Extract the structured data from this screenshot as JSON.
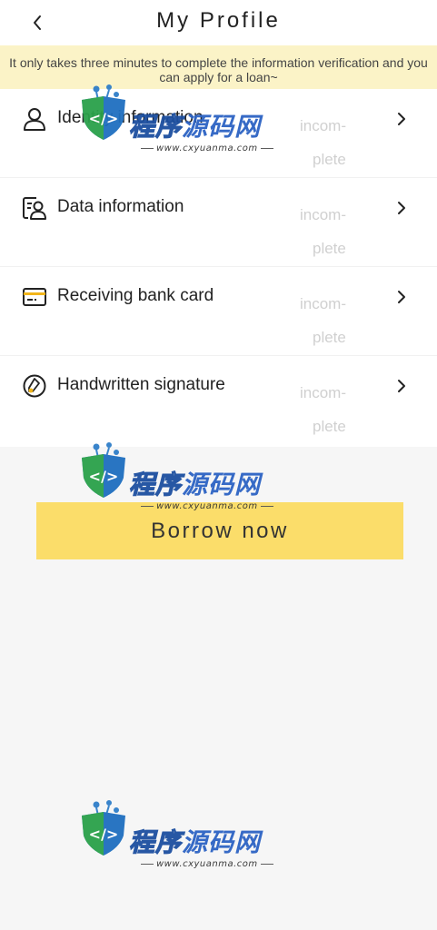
{
  "header": {
    "title": "My Profile",
    "back_icon": "chevron-left-icon"
  },
  "notice": {
    "line1": "It only takes three minutes to complete the information verification and you",
    "line2": "can apply for a loan~"
  },
  "items": [
    {
      "label": "Identity information",
      "status_line1": "incom-",
      "status_line2": "plete",
      "icon": "person-icon"
    },
    {
      "label": "Data information",
      "status_line1": "incom-",
      "status_line2": "plete",
      "icon": "id-card-icon"
    },
    {
      "label": "Receiving bank card",
      "status_line1": "incom-",
      "status_line2": "plete",
      "icon": "bank-card-icon"
    },
    {
      "label": "Handwritten signature",
      "status_line1": "incom-",
      "status_line2": "plete",
      "icon": "signature-icon"
    }
  ],
  "borrow_button": {
    "label": "Borrow now"
  },
  "watermark": {
    "brand_part1": "程序",
    "brand_part2": "源码网",
    "url": "www.cxyuanma.com"
  },
  "colors": {
    "accent": "#fbdd6a",
    "notice_bg": "#fbf3c7",
    "status_text": "#d0d0d0",
    "page_bg": "#f6f6f6"
  }
}
